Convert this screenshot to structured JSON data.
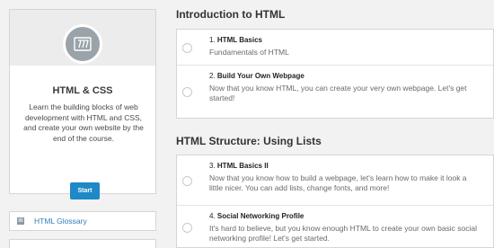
{
  "course": {
    "logo_icon": "html5-shield-icon",
    "title": "HTML & CSS",
    "description": "Learn the building blocks of web development with HTML and CSS, and create your own website by the end of the course.",
    "start_label": "Start",
    "accent_color": "#1f88c7"
  },
  "glossary": {
    "icon": "book-icon",
    "label": "HTML Glossary"
  },
  "sections": [
    {
      "title": "Introduction to HTML",
      "lessons": [
        {
          "number": "1.",
          "name": "HTML Basics",
          "description": "Fundamentals of HTML"
        },
        {
          "number": "2.",
          "name": "Build Your Own Webpage",
          "description": "Now that you know HTML, you can create your very own webpage. Let's get started!"
        }
      ]
    },
    {
      "title": "HTML Structure: Using Lists",
      "lessons": [
        {
          "number": "3.",
          "name": "HTML Basics II",
          "description": "Now that you know how to build a webpage, let's learn how to make it look a little nicer. You can add lists, change fonts, and more!"
        },
        {
          "number": "4.",
          "name": "Social Networking Profile",
          "description": "It's hard to believe, but you know enough HTML to create your own basic social networking profile! Let's get started."
        }
      ]
    }
  ]
}
